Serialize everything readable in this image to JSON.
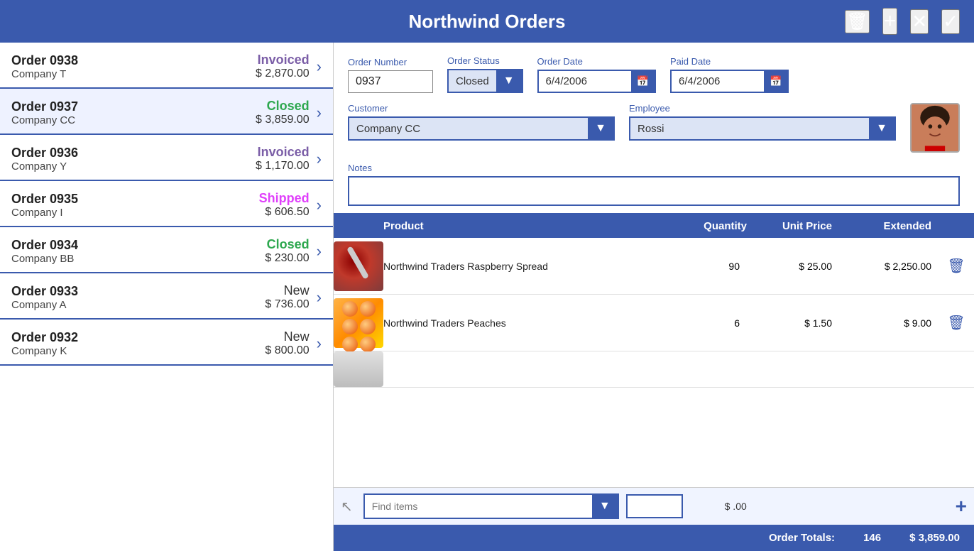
{
  "app": {
    "title": "Northwind Orders"
  },
  "header": {
    "delete_label": "🗑",
    "add_label": "+",
    "close_label": "✕",
    "confirm_label": "✓"
  },
  "orders": [
    {
      "number": "Order 0938",
      "company": "Company T",
      "amount": "$ 2,870.00",
      "status": "Invoiced",
      "status_class": "invoiced"
    },
    {
      "number": "Order 0937",
      "company": "Company CC",
      "amount": "$ 3,859.00",
      "status": "Closed",
      "status_class": "closed"
    },
    {
      "number": "Order 0936",
      "company": "Company Y",
      "amount": "$ 1,170.00",
      "status": "Invoiced",
      "status_class": "invoiced"
    },
    {
      "number": "Order 0935",
      "company": "Company I",
      "amount": "$ 606.50",
      "status": "Shipped",
      "status_class": "shipped"
    },
    {
      "number": "Order 0934",
      "company": "Company BB",
      "amount": "$ 230.00",
      "status": "Closed",
      "status_class": "closed"
    },
    {
      "number": "Order 0933",
      "company": "Company A",
      "amount": "$ 736.00",
      "status": "New",
      "status_class": "new"
    },
    {
      "number": "Order 0932",
      "company": "Company K",
      "amount": "$ 800.00",
      "status": "New",
      "status_class": "new"
    }
  ],
  "detail": {
    "order_number_label": "Order Number",
    "order_number_value": "0937",
    "order_status_label": "Order Status",
    "order_status_value": "Closed",
    "order_date_label": "Order Date",
    "order_date_value": "6/4/2006",
    "paid_date_label": "Paid Date",
    "paid_date_value": "6/4/2006",
    "customer_label": "Customer",
    "customer_value": "Company CC",
    "employee_label": "Employee",
    "employee_value": "Rossi",
    "notes_label": "Notes",
    "notes_value": ""
  },
  "table": {
    "col_product": "Product",
    "col_quantity": "Quantity",
    "col_unit_price": "Unit Price",
    "col_extended": "Extended"
  },
  "products": [
    {
      "name": "Northwind Traders Raspberry Spread",
      "quantity": "90",
      "unit_price": "$ 25.00",
      "extended": "$ 2,250.00",
      "type": "jam"
    },
    {
      "name": "Northwind Traders Peaches",
      "quantity": "6",
      "unit_price": "$ 1.50",
      "extended": "$ 9.00",
      "type": "peaches"
    },
    {
      "name": "",
      "quantity": "",
      "unit_price": "",
      "extended": "",
      "type": "partial"
    }
  ],
  "add_item": {
    "placeholder": "Find items",
    "amount": "$ .00",
    "add_label": "+"
  },
  "totals": {
    "label": "Order Totals:",
    "quantity": "146",
    "amount": "$ 3,859.00"
  }
}
